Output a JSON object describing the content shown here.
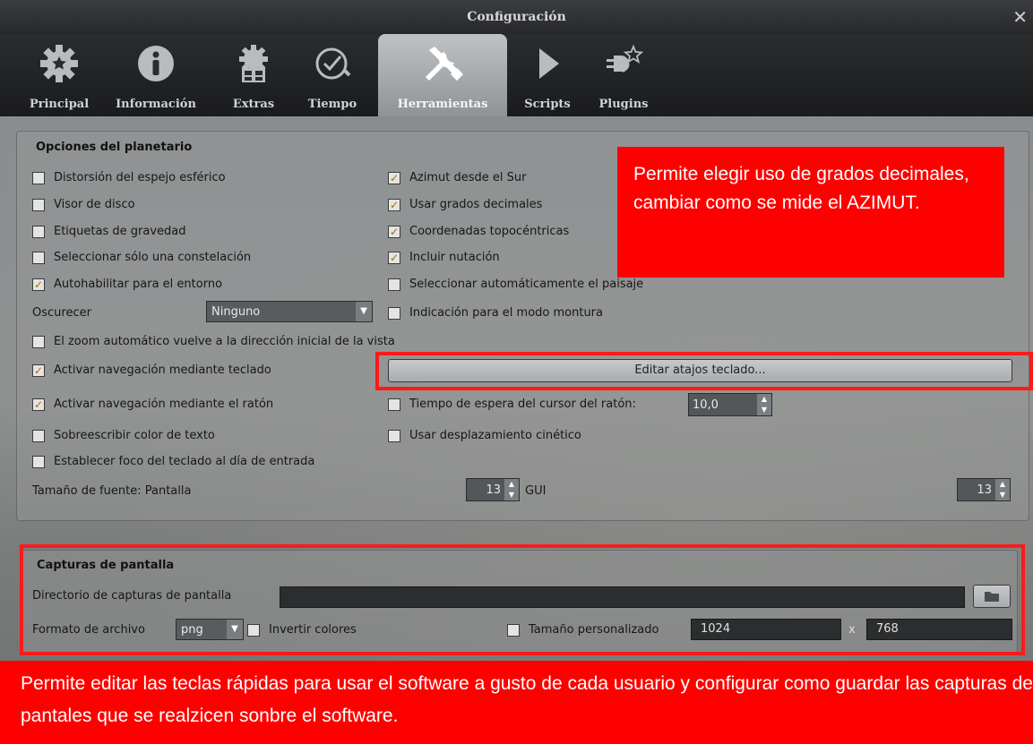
{
  "window": {
    "title": "Configuración",
    "close_glyph": "✕"
  },
  "tabs": [
    {
      "label": "Principal",
      "icon": "gear-icon"
    },
    {
      "label": "Información",
      "icon": "info-icon"
    },
    {
      "label": "Extras",
      "icon": "extras-icon"
    },
    {
      "label": "Tiempo",
      "icon": "clock-icon"
    },
    {
      "label": "Herramientas",
      "icon": "tools-icon",
      "active": true
    },
    {
      "label": "Scripts",
      "icon": "play-icon"
    },
    {
      "label": "Plugins",
      "icon": "plugin-icon"
    }
  ],
  "planetarium": {
    "title": "Opciones del planetario",
    "left_options": [
      {
        "label": "Distorsión del espejo esférico",
        "checked": false
      },
      {
        "label": "Visor de disco",
        "checked": false
      },
      {
        "label": "Etiquetas de gravedad",
        "checked": false
      },
      {
        "label": "Seleccionar sólo una constelación",
        "checked": false
      },
      {
        "label": "Autohabilitar para el entorno",
        "checked": true
      }
    ],
    "right_options": [
      {
        "label": "Azimut desde el Sur",
        "checked": true
      },
      {
        "label": "Usar grados decimales",
        "checked": true
      },
      {
        "label": "Coordenadas topocéntricas",
        "checked": true
      },
      {
        "label": "Incluir nutación",
        "checked": true
      },
      {
        "label": "Seleccionar automáticamente el paisaje",
        "checked": false
      },
      {
        "label": "Indicación para el modo montura",
        "checked": false
      }
    ],
    "dim_label": "Oscurecer",
    "dim_value": "Ninguno",
    "zoom_option": {
      "label": "El zoom automático vuelve a la dirección inicial de la vista",
      "checked": false
    },
    "keyboard_nav": {
      "label": "Activar navegación mediante teclado",
      "checked": true
    },
    "edit_shortcuts_button": "Editar atajos teclado...",
    "mouse_nav": {
      "label": "Activar navegación mediante el ratón",
      "checked": true
    },
    "mouse_timeout": {
      "label": "Tiempo de espera del cursor del ratón:",
      "checked": false,
      "value": "10,0"
    },
    "text_color": {
      "label": "Sobreescribir color de texto",
      "checked": false
    },
    "kinetic": {
      "label": "Usar desplazamiento cinético",
      "checked": false
    },
    "focus_date": {
      "label": "Establecer foco del teclado al día de entrada",
      "checked": false
    },
    "font_size_label": "Tamaño de fuente: Pantalla",
    "font_screen": "13",
    "gui_label": "GUI",
    "font_gui": "13"
  },
  "screenshots": {
    "title": "Capturas de pantalla",
    "dir_label": "Directorio de capturas de pantalla",
    "dir_value": "",
    "format_label": "Formato de archivo",
    "format_value": "png",
    "invert_label": "Invertir colores",
    "invert_checked": false,
    "custom_size_label": "Tamaño personalizado",
    "custom_size_checked": false,
    "width": "1024",
    "x_sep": "x",
    "height": "768"
  },
  "callouts": {
    "top_right": "Permite elegir uso de grados decimales, cambiar como se mide el AZIMUT.",
    "bottom": "Permite editar las teclas rápidas para usar el software a gusto de cada usuario y configurar como guardar las capturas de pantales que se realzicen sonbre el software."
  },
  "colors": {
    "annotation_red": "#ff0000",
    "checkmark": "#b06a00"
  }
}
